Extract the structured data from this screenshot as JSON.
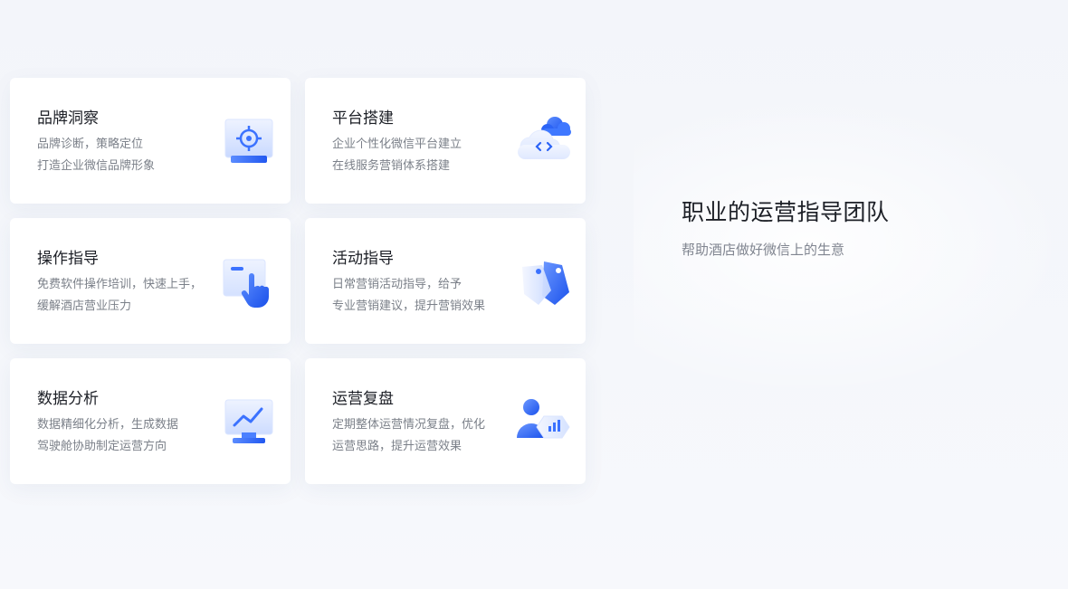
{
  "cards": [
    {
      "title": "品牌洞察",
      "desc": [
        "品牌诊断，策略定位",
        "打造企业微信品牌形象"
      ],
      "icon": "target-monitor-icon"
    },
    {
      "title": "平台搭建",
      "desc": [
        "企业个性化微信平台建立",
        "在线服务营销体系搭建"
      ],
      "icon": "cloud-code-icon"
    },
    {
      "title": "操作指导",
      "desc": [
        "免费软件操作培训，快速上手，",
        "缓解酒店营业压力"
      ],
      "icon": "hand-click-icon"
    },
    {
      "title": "活动指导",
      "desc": [
        "日常营销活动指导，给予",
        "专业营销建议，提升营销效果"
      ],
      "icon": "tag-icon"
    },
    {
      "title": "数据分析",
      "desc": [
        "数据精细化分析，生成数据",
        "驾驶舱协助制定运营方向"
      ],
      "icon": "chart-monitor-icon"
    },
    {
      "title": "运营复盘",
      "desc": [
        "定期整体运营情况复盘，优化",
        "运营思路，提升运营效果"
      ],
      "icon": "user-chart-icon"
    }
  ],
  "hero": {
    "title": "职业的运营指导团队",
    "subtitle": "帮助酒店做好微信上的生意"
  },
  "colors": {
    "accent": "#2f6bff",
    "accent_light": "#8fb3ff",
    "title_text": "#1c1f26",
    "desc_text": "#7b8089"
  }
}
